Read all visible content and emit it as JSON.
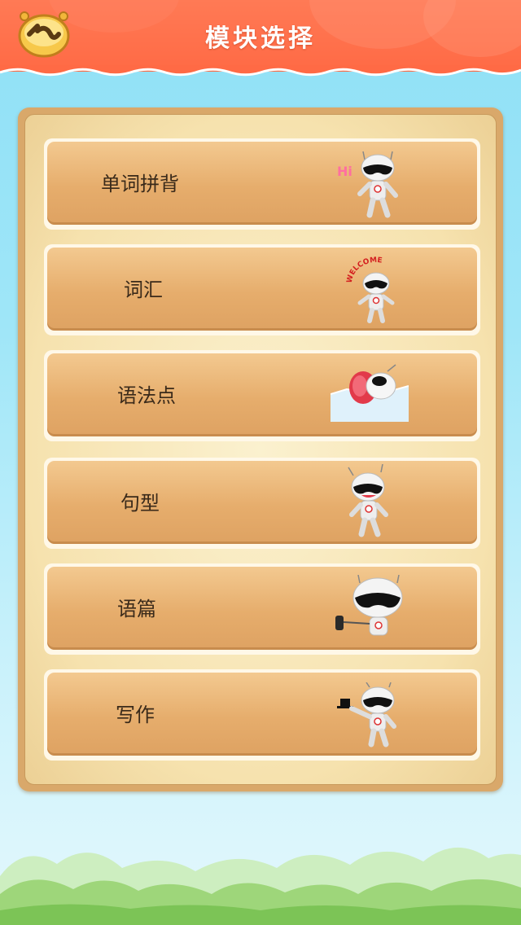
{
  "header": {
    "title": "模块选择",
    "back_icon": "back-arrow-icon"
  },
  "modules": [
    {
      "label": "单词拼背",
      "robot": "robot-hi-icon",
      "robot_caption": "Hi"
    },
    {
      "label": "词汇",
      "robot": "robot-welcome-icon",
      "robot_caption": "WELCOME"
    },
    {
      "label": "语法点",
      "robot": "robot-sleeping-icon"
    },
    {
      "label": "句型",
      "robot": "robot-standing-icon"
    },
    {
      "label": "语篇",
      "robot": "robot-guitar-icon"
    },
    {
      "label": "写作",
      "robot": "robot-hat-icon"
    }
  ],
  "colors": {
    "header": "#ff6a45",
    "sky": "#9fe6f8",
    "panel": "#d9a86a",
    "button": "#e6ad6c",
    "grass": "#8fd06a"
  }
}
